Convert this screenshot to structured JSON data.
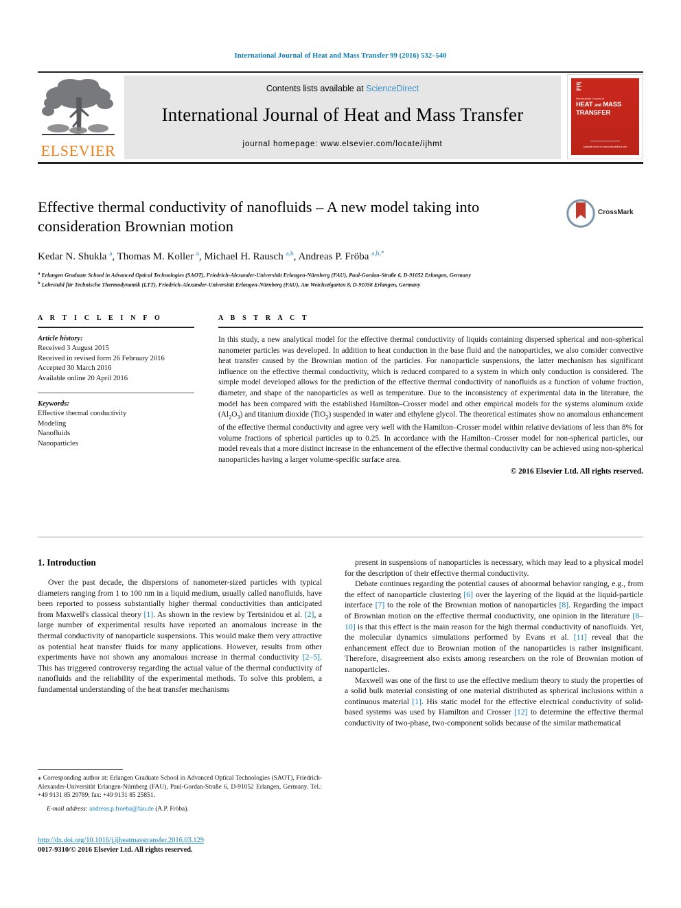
{
  "running_head": "International Journal of Heat and Mass Transfer 99 (2016) 532–540",
  "masthead": {
    "publisher_name": "ELSEVIER",
    "contents_prefix": "Contents lists available at ",
    "contents_link": "ScienceDirect",
    "journal_title": "International Journal of Heat and Mass Transfer",
    "homepage_label": "journal homepage: www.elsevier.com/locate/ijhmt",
    "cover": {
      "superline": "International Journal of",
      "line1": "HEAT",
      "and": "and",
      "line2": "MASS",
      "line3": "TRANSFER",
      "footer": "Available online at www.sciencedirect.com"
    }
  },
  "article": {
    "title": "Effective thermal conductivity of nanofluids – A new model taking into consideration Brownian motion",
    "crossmark_label": "CrossMark",
    "authors_html": "Kedar N. Shukla <sup>a</sup>, Thomas M. Koller <sup>a</sup>, Michael H. Rausch <sup>a,b</sup>, Andreas P. Fröba <sup>a,b,</sup><sup>*</sup>",
    "affiliation_a": "Erlangen Graduate School in Advanced Optical Technologies (SAOT), Friedrich-Alexander-Universität Erlangen-Nürnberg (FAU), Paul-Gordan-Straße 6, D-91052 Erlangen, Germany",
    "affiliation_b": "Lehrstuhl für Technische Thermodynamik (LTT), Friedrich-Alexander-Universität Erlangen-Nürnberg (FAU), Am Weichselgarten 8, D-91058 Erlangen, Germany"
  },
  "article_info": {
    "heading": "A R T I C L E   I N F O",
    "history_label": "Article history:",
    "history": [
      "Received 3 August 2015",
      "Received in revised form 26 February 2016",
      "Accepted 30 March 2016",
      "Available online 20 April 2016"
    ],
    "keywords_label": "Keywords:",
    "keywords": [
      "Effective thermal conductivity",
      "Modeling",
      "Nanofluids",
      "Nanoparticles"
    ]
  },
  "abstract": {
    "heading": "A B S T R A C T",
    "text_html": "In this study, a new analytical model for the effective thermal conductivity of liquids containing dispersed spherical and non-spherical nanometer particles was developed. In addition to heat conduction in the base fluid and the nanoparticles, we also consider convective heat transfer caused by the Brownian motion of the particles. For nanoparticle suspensions, the latter mechanism has significant influence on the effective thermal conductivity, which is reduced compared to a system in which only conduction is considered. The simple model developed allows for the prediction of the effective thermal conductivity of nanofluids as a function of volume fraction, diameter, and shape of the nanoparticles as well as temperature. Due to the inconsistency of experimental data in the literature, the model has been compared with the established Hamilton–Crosser model and other empirical models for the systems aluminum oxide (Al<sub>2</sub>O<sub>3</sub>) and titanium dioxide (TiO<sub>2</sub>) suspended in water and ethylene glycol. The theoretical estimates show no anomalous enhancement of the effective thermal conductivity and agree very well with the Hamilton–Crosser model within relative deviations of less than 8% for volume fractions of spherical particles up to 0.25. In accordance with the Hamilton–Crosser model for non-spherical particles, our model reveals that a more distinct increase in the enhancement of the effective thermal conductivity can be achieved using non-spherical nanoparticles having a larger volume-specific surface area.",
    "copyright": "© 2016 Elsevier Ltd. All rights reserved."
  },
  "body": {
    "section_heading": "1. Introduction",
    "left_paragraphs_html": [
      "Over the past decade, the dispersions of nanometer-sized particles with typical diameters ranging from 1 to 100 nm in a liquid medium, usually called nanofluids, have been reported to possess substantially higher thermal conductivities than anticipated from Maxwell's classical theory <span class=\"ref\">[1]</span>. As shown in the review by Tertsinidou et al. <span class=\"ref\">[2]</span>, a large number of experimental results have reported an anomalous increase in the thermal conductivity of nanoparticle suspensions. This would make them very attractive as potential heat transfer fluids for many applications. However, results from other experiments have not shown any anomalous increase in thermal conductivity <span class=\"ref\">[2–5]</span>. This has triggered controversy regarding the actual value of the thermal conductivity of nanofluids and the reliability of the experimental methods. To solve this problem, a fundamental understanding of the heat transfer mechanisms"
    ],
    "right_paragraphs_html": [
      "present in suspensions of nanoparticles is necessary, which may lead to a physical model for the description of their effective thermal conductivity.",
      "Debate continues regarding the potential causes of abnormal behavior ranging, e.g., from the effect of nanoparticle clustering <span class=\"ref\">[6]</span> over the layering of the liquid at the liquid-particle interface <span class=\"ref\">[7]</span> to the role of the Brownian motion of nanoparticles <span class=\"ref\">[8]</span>. Regarding the impact of Brownian motion on the effective thermal conductivity, one opinion in the literature <span class=\"ref\">[8–10]</span> is that this effect is the main reason for the high thermal conductivity of nanofluids. Yet, the molecular dynamics simulations performed by Evans et al. <span class=\"ref\">[11]</span> reveal that the enhancement effect due to Brownian motion of the nanoparticles is rather insignificant. Therefore, disagreement also exists among researchers on the role of Brownian motion of nanoparticles.",
      "Maxwell was one of the first to use the effective medium theory to study the properties of a solid bulk material consisting of one material distributed as spherical inclusions within a continuous material <span class=\"ref\">[1]</span>. His static model for the effective electrical conductivity of solid-based systems was used by Hamilton and Crosser <span class=\"ref\">[12]</span> to determine the effective thermal conductivity of two-phase, two-component solids because of the similar mathematical"
    ]
  },
  "footnotes": {
    "corresponding_html": "<span class=\"star\">⁎</span> Corresponding author at: Erlangen Graduate School in Advanced Optical Technologies (SAOT), Friedrich-Alexander-Universität Erlangen-Nürnberg (FAU), Paul-Gordan-Straße 6, D-91052 Erlangen, Germany. Tel.: +49 9131 85 29789; fax: +49 9131 85 25851.",
    "email_label": "E-mail address:",
    "email": "andreas.p.froeba@fau.de",
    "email_suffix": "(A.P. Fröba).",
    "doi": "http://dx.doi.org/10.1016/j.ijheatmasstransfer.2016.03.129",
    "issn_line": "0017-9310/© 2016 Elsevier Ltd. All rights reserved."
  },
  "colors": {
    "link_blue": "#0b7ab5",
    "elsevier_orange": "#ee8019",
    "cover_red": "#c0392b",
    "band_gray": "#e6e6e6"
  }
}
